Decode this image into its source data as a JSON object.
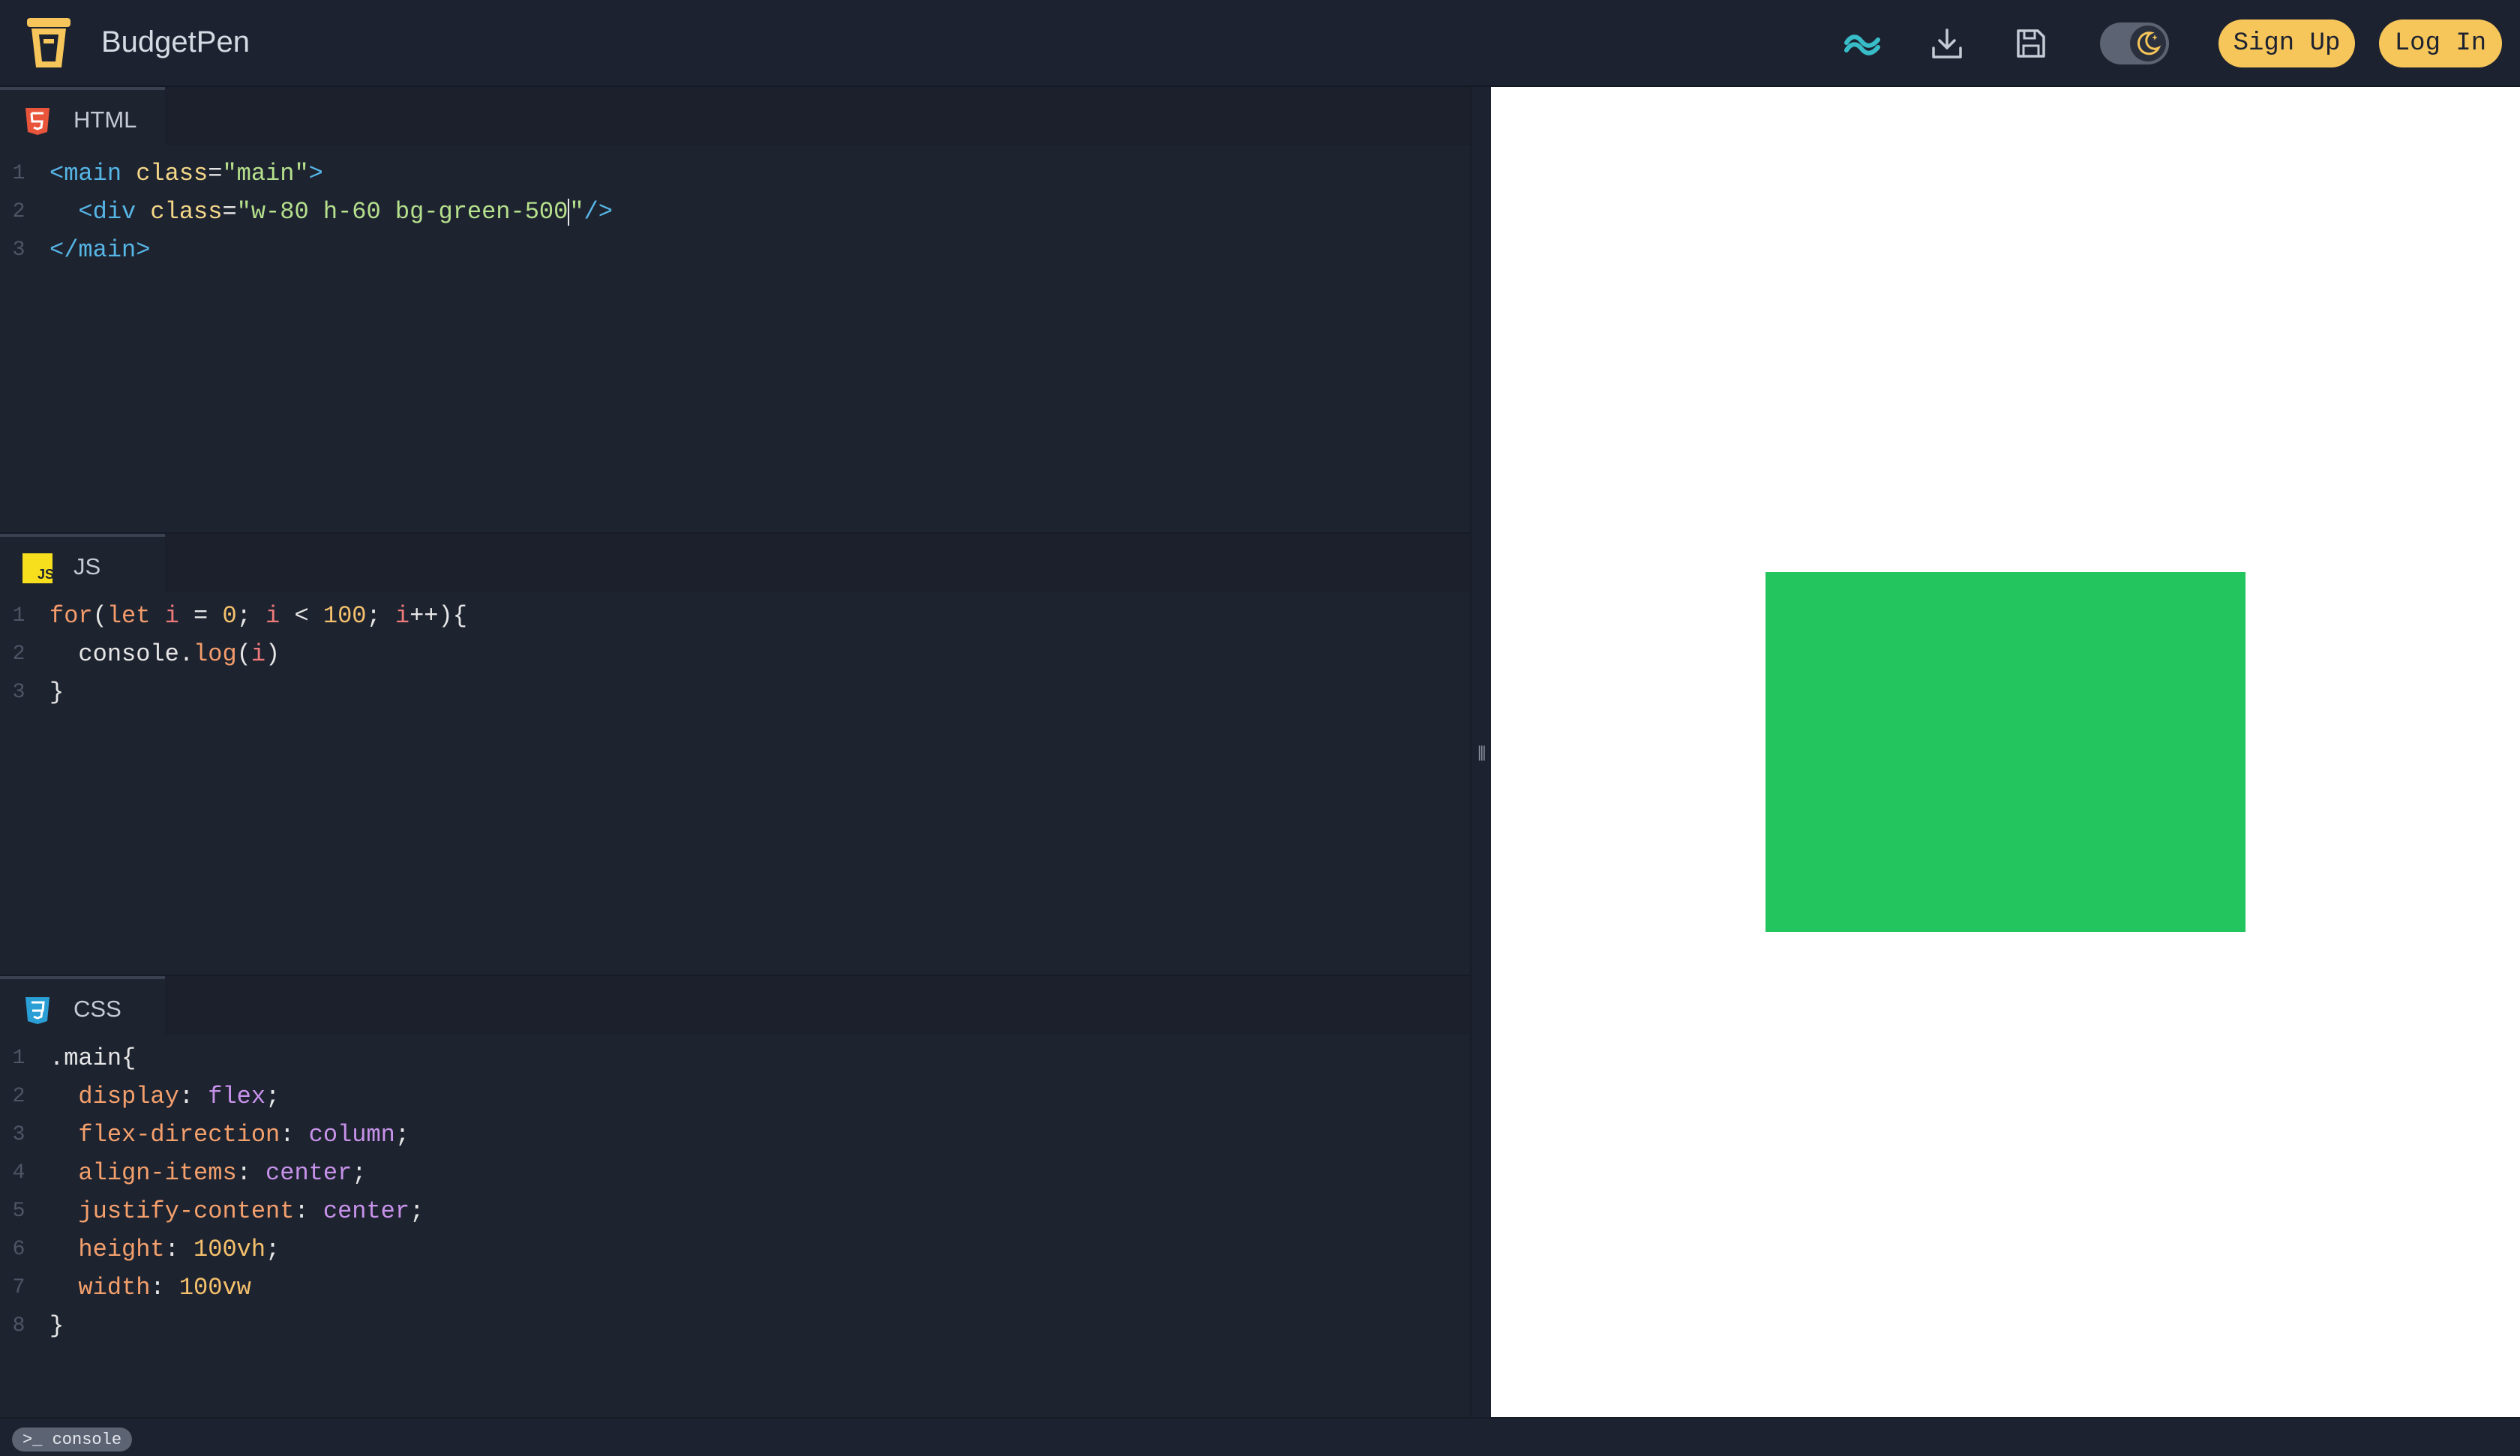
{
  "app": {
    "title": "BudgetPen"
  },
  "header": {
    "icons": [
      "tailwind-icon",
      "download-icon",
      "save-icon"
    ],
    "theme_toggle": "dark",
    "signup_label": "Sign Up",
    "login_label": "Log In"
  },
  "panes": {
    "html": {
      "label": "HTML",
      "lines": [
        [
          {
            "t": "<main ",
            "c": "tag"
          },
          {
            "t": "class",
            "c": "attr"
          },
          {
            "t": "=",
            "c": "plain"
          },
          {
            "t": "\"main\"",
            "c": "str"
          },
          {
            "t": ">",
            "c": "tag"
          }
        ],
        [
          {
            "t": "  <div ",
            "c": "tag"
          },
          {
            "t": "class",
            "c": "attr"
          },
          {
            "t": "=",
            "c": "plain"
          },
          {
            "t": "\"w-80 h-60 bg-green-500",
            "c": "str"
          },
          {
            "t": "|",
            "c": "cursor"
          },
          {
            "t": "\"",
            "c": "str"
          },
          {
            "t": "/>",
            "c": "tag"
          }
        ],
        [
          {
            "t": "</main>",
            "c": "tag"
          }
        ]
      ]
    },
    "js": {
      "label": "JS",
      "lines": [
        [
          {
            "t": "for",
            "c": "kw"
          },
          {
            "t": "(",
            "c": "plain"
          },
          {
            "t": "let ",
            "c": "kw"
          },
          {
            "t": "i",
            "c": "var"
          },
          {
            "t": " = ",
            "c": "plain"
          },
          {
            "t": "0",
            "c": "num"
          },
          {
            "t": "; ",
            "c": "plain"
          },
          {
            "t": "i",
            "c": "var"
          },
          {
            "t": " < ",
            "c": "plain"
          },
          {
            "t": "100",
            "c": "num"
          },
          {
            "t": "; ",
            "c": "plain"
          },
          {
            "t": "i",
            "c": "var"
          },
          {
            "t": "++){",
            "c": "plain"
          }
        ],
        [
          {
            "t": "  console.",
            "c": "plain"
          },
          {
            "t": "log",
            "c": "kw"
          },
          {
            "t": "(",
            "c": "plain"
          },
          {
            "t": "i",
            "c": "var"
          },
          {
            "t": ")",
            "c": "plain"
          }
        ],
        [
          {
            "t": "}",
            "c": "plain"
          }
        ]
      ]
    },
    "css": {
      "label": "CSS",
      "lines": [
        [
          {
            "t": ".main{",
            "c": "plain"
          }
        ],
        [
          {
            "t": "  display",
            "c": "prop"
          },
          {
            "t": ": ",
            "c": "plain"
          },
          {
            "t": "flex",
            "c": "val"
          },
          {
            "t": ";",
            "c": "plain"
          }
        ],
        [
          {
            "t": "  flex-direction",
            "c": "prop"
          },
          {
            "t": ": ",
            "c": "plain"
          },
          {
            "t": "column",
            "c": "val"
          },
          {
            "t": ";",
            "c": "plain"
          }
        ],
        [
          {
            "t": "  align-items",
            "c": "prop"
          },
          {
            "t": ": ",
            "c": "plain"
          },
          {
            "t": "center",
            "c": "val"
          },
          {
            "t": ";",
            "c": "plain"
          }
        ],
        [
          {
            "t": "  justify-content",
            "c": "prop"
          },
          {
            "t": ": ",
            "c": "plain"
          },
          {
            "t": "center",
            "c": "val"
          },
          {
            "t": ";",
            "c": "plain"
          }
        ],
        [
          {
            "t": "  height",
            "c": "prop"
          },
          {
            "t": ": ",
            "c": "plain"
          },
          {
            "t": "100vh",
            "c": "num"
          },
          {
            "t": ";",
            "c": "plain"
          }
        ],
        [
          {
            "t": "  width",
            "c": "prop"
          },
          {
            "t": ": ",
            "c": "plain"
          },
          {
            "t": "100vw",
            "c": "num"
          }
        ],
        [
          {
            "t": "}",
            "c": "plain"
          }
        ]
      ]
    }
  },
  "preview": {
    "box_color": "#22c55e",
    "background": "#ffffff"
  },
  "console": {
    "label": ">_ console"
  },
  "colors": {
    "accent": "#f7c65a",
    "editor_bg": "#1e2330"
  }
}
